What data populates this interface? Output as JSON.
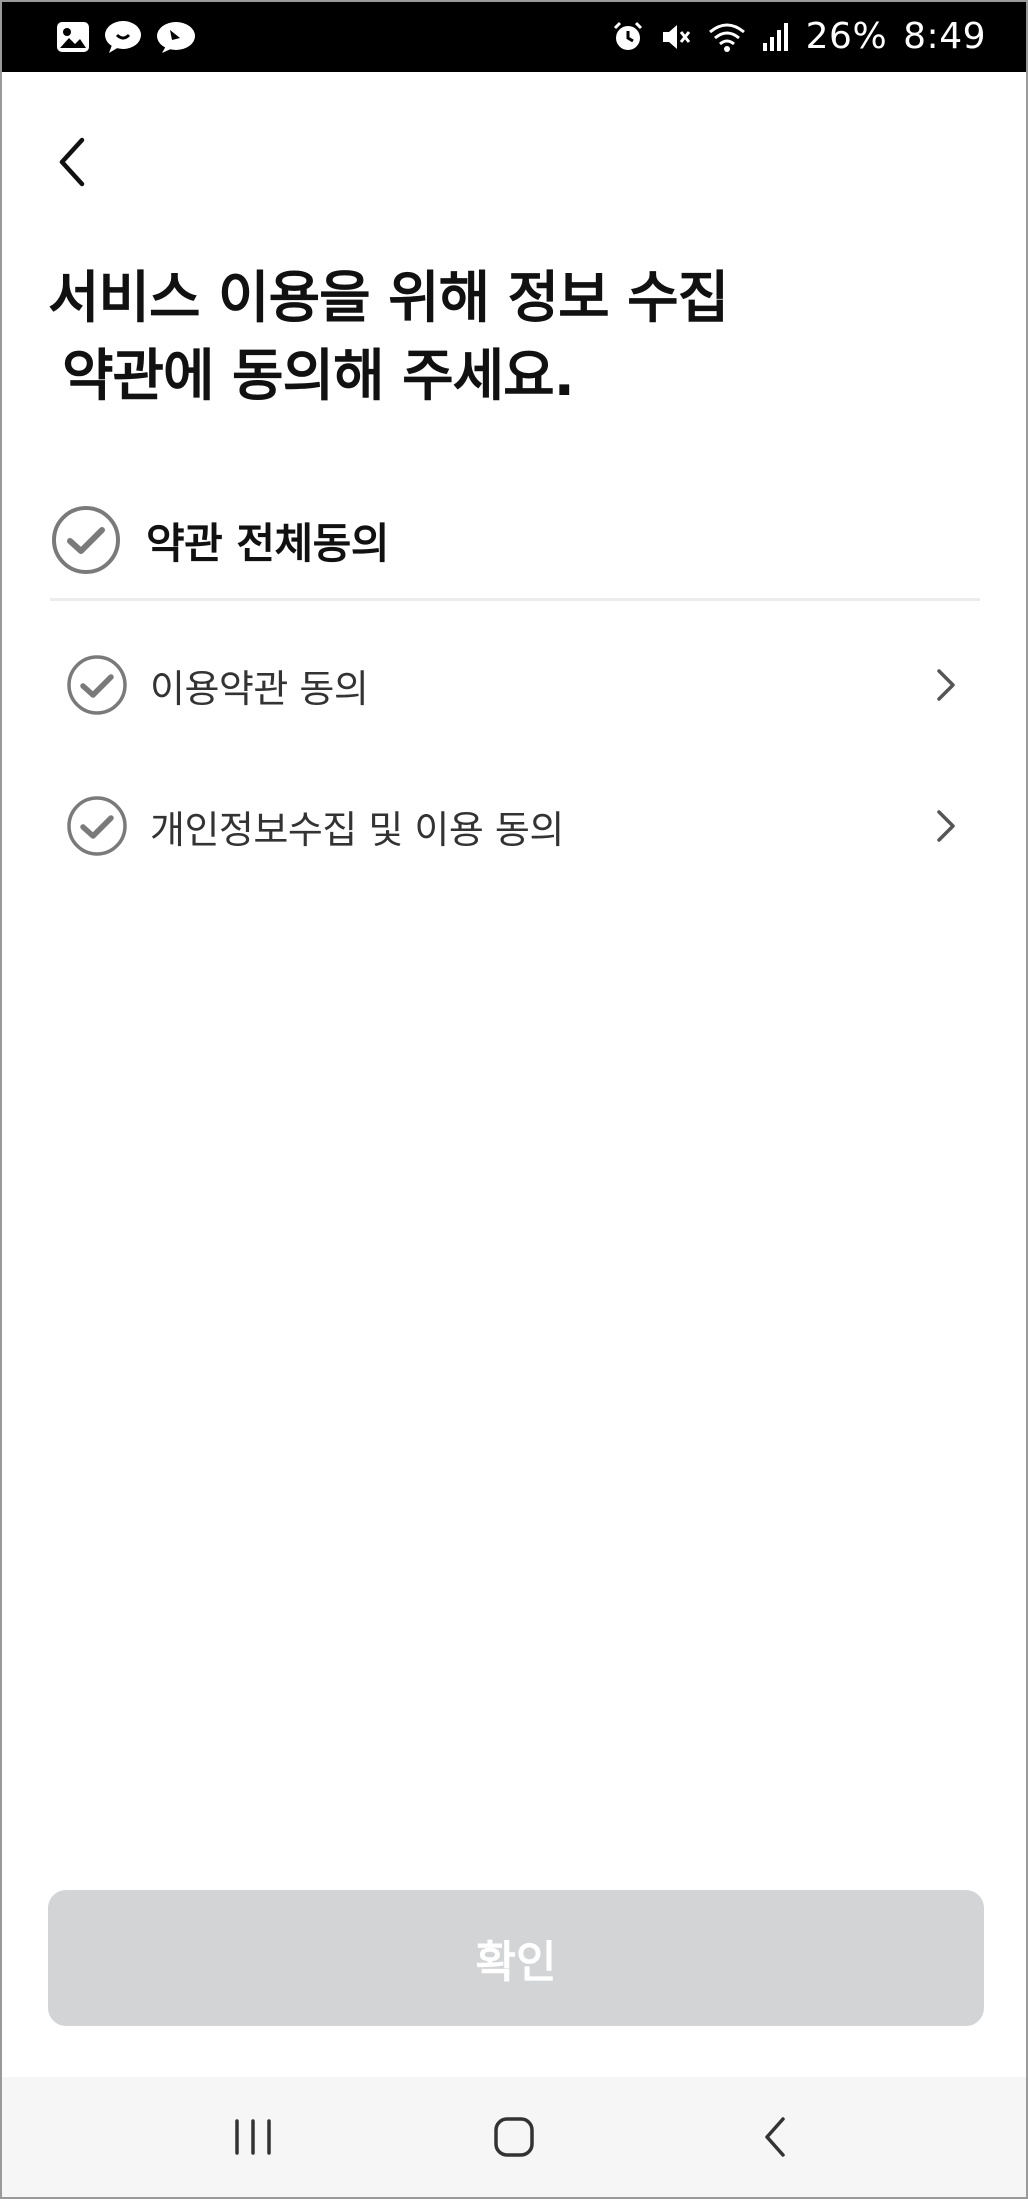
{
  "status_bar": {
    "battery": "26%",
    "time": "8:49",
    "left_icons": [
      "gallery-icon",
      "chat-bubble-icon",
      "talk-icon"
    ],
    "right_icons": [
      "alarm-icon",
      "mute-icon",
      "wifi-icon",
      "signal-icon"
    ]
  },
  "header": {
    "back_icon": "back-chevron-icon"
  },
  "title": {
    "line1": "서비스 이용을 위해 정보 수집",
    "line2": "약관에 동의해 주세요."
  },
  "agree_all": {
    "label": "약관 전체동의",
    "checked": true
  },
  "terms": [
    {
      "label": "이용약관 동의",
      "checked": true
    },
    {
      "label": "개인정보수집 및 이용 동의",
      "checked": true
    }
  ],
  "confirm": {
    "label": "확인",
    "enabled": false
  },
  "colors": {
    "check_gray": "#7a7a7a",
    "button_disabled": "#d3d4d6",
    "nav_bg": "#f6f6f7"
  }
}
